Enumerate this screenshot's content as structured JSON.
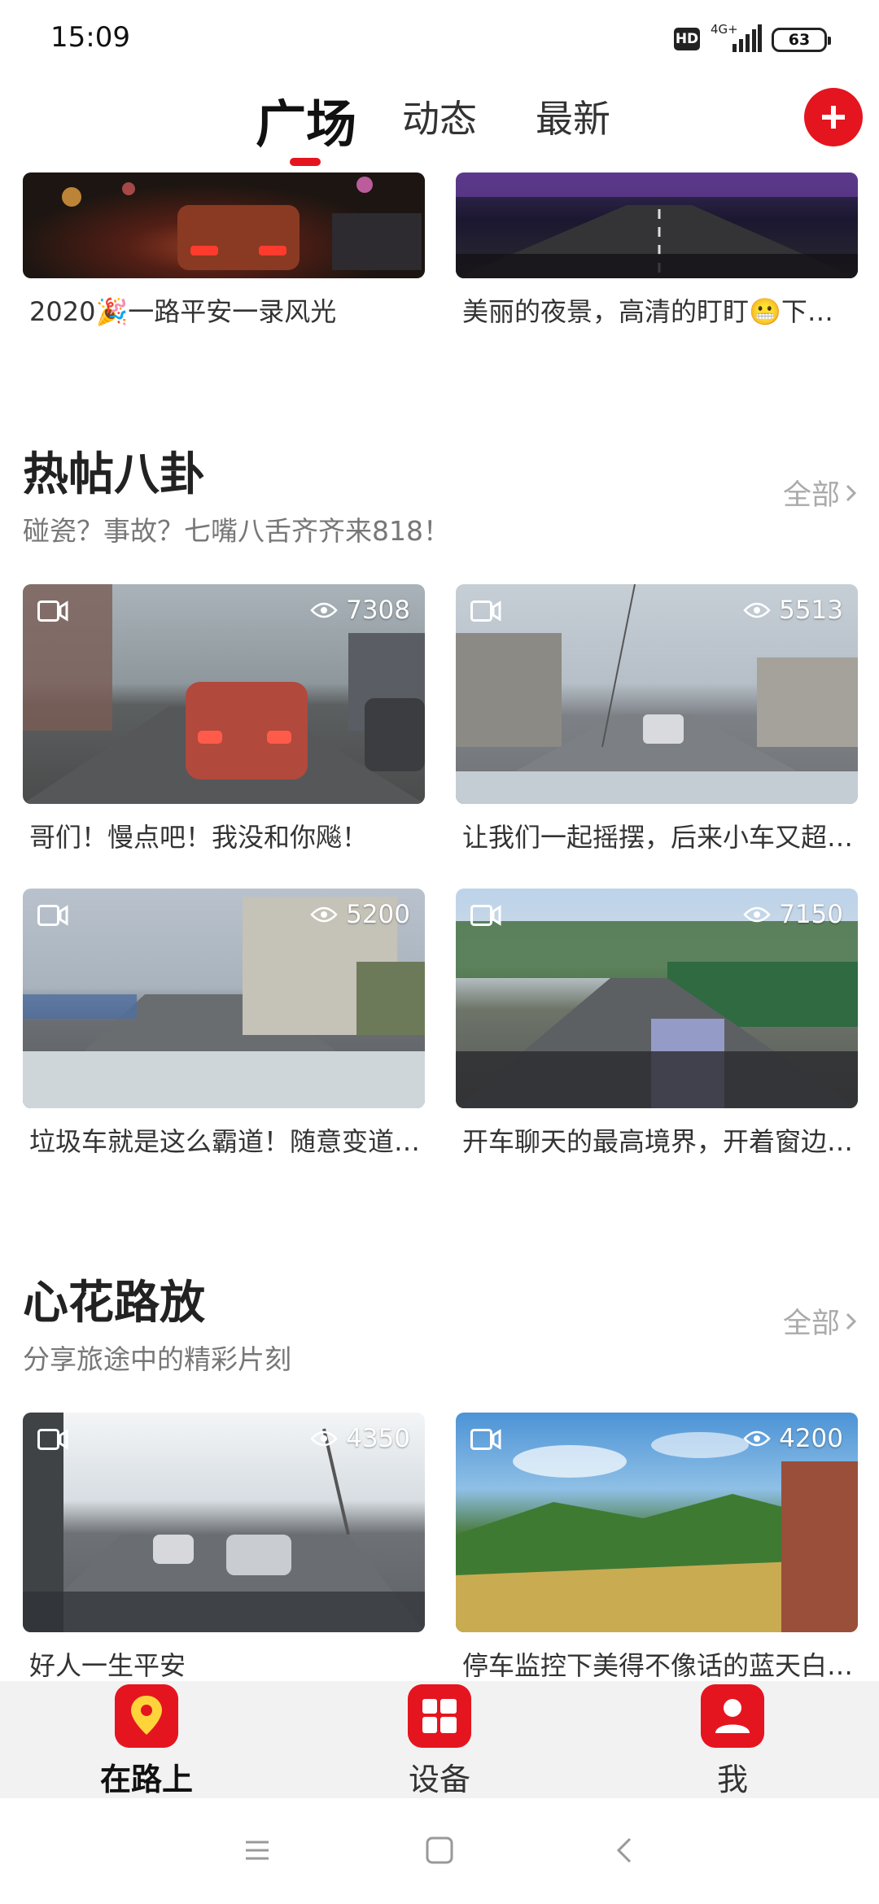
{
  "status_bar": {
    "time": "15:09",
    "hd_label": "HD",
    "network": "4G+",
    "battery": "63"
  },
  "tabs": [
    {
      "label": "广场",
      "active": true
    },
    {
      "label": "动态",
      "active": false
    },
    {
      "label": "最新",
      "active": false
    }
  ],
  "top_cards": [
    {
      "title": "2020🎉一路平安一录风光"
    },
    {
      "title": "美丽的夜景，高清的盯盯😬下班…"
    }
  ],
  "sections": [
    {
      "title": "热帖八卦",
      "subtitle": "碰瓷？事故？七嘴八舌齐齐来818！",
      "see_all": "全部",
      "cards": [
        {
          "title": "哥们！慢点吧！我没和你飚！",
          "views": "7308"
        },
        {
          "title": "让我们一起摇摆，后来小车又超…",
          "views": "5513"
        },
        {
          "title": "垃圾车就是这么霸道！随意变道…",
          "views": "5200"
        },
        {
          "title": "开车聊天的最高境界，开着窗边…",
          "views": "7150"
        }
      ]
    },
    {
      "title": "心花路放",
      "subtitle": "分享旅途中的精彩片刻",
      "see_all": "全部",
      "cards": [
        {
          "title": "好人一生平安",
          "views": "4350"
        },
        {
          "title": "停车监控下美得不像话的蓝天白…",
          "views": "4200"
        }
      ]
    }
  ],
  "bottom_nav": [
    {
      "label": "在路上",
      "icon": "location-pin-icon",
      "active": true
    },
    {
      "label": "设备",
      "icon": "device-grid-icon",
      "active": false
    },
    {
      "label": "我",
      "icon": "user-icon",
      "active": false
    }
  ],
  "colors": {
    "accent": "#e5151f",
    "nav_bg": "#f2f2f2"
  }
}
